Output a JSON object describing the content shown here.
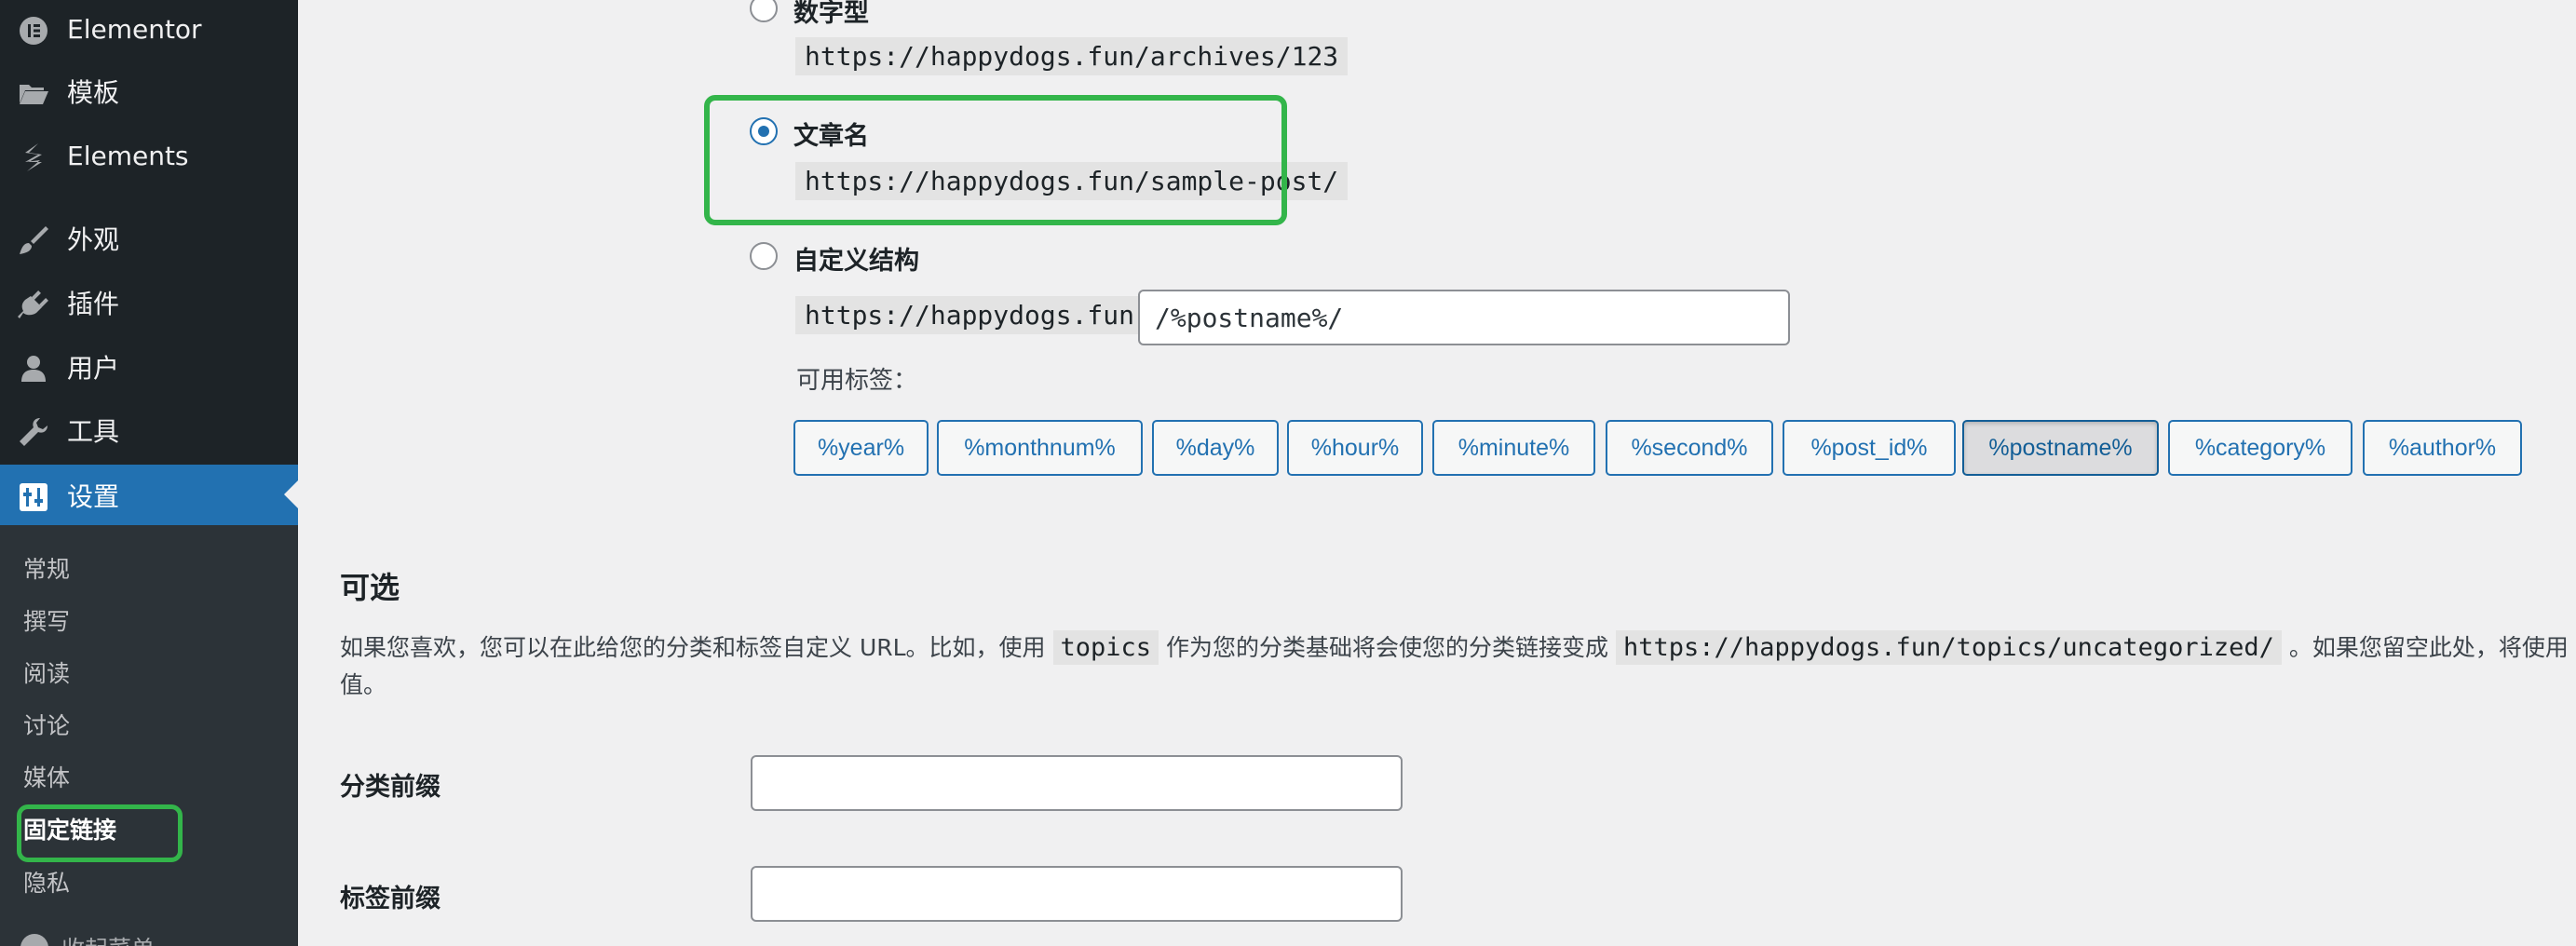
{
  "sidebar": {
    "menu": [
      {
        "label": "Elementor",
        "icon": "elementor-icon"
      },
      {
        "label": "模板",
        "icon": "folder-icon"
      },
      {
        "label": "Elements",
        "icon": "elements-icon"
      },
      {
        "label": "外观",
        "icon": "paintbrush-icon"
      },
      {
        "label": "插件",
        "icon": "plugin-icon"
      },
      {
        "label": "用户",
        "icon": "user-icon"
      },
      {
        "label": "工具",
        "icon": "wrench-icon"
      },
      {
        "label": "设置",
        "icon": "settings-icon"
      }
    ],
    "submenu": [
      "常规",
      "撰写",
      "阅读",
      "讨论",
      "媒体",
      "固定链接",
      "隐私",
      "收起菜单"
    ]
  },
  "permalink": {
    "numeric": {
      "label": "数字型",
      "example": "https://happydogs.fun/archives/123"
    },
    "post_name": {
      "label": "文章名",
      "example": "https://happydogs.fun/sample-post/"
    },
    "custom": {
      "label": "自定义结构",
      "prefix": "https://happydogs.fun",
      "value": "/%postname%/"
    },
    "available_tags_label": "可用标签：",
    "tags": [
      "%year%",
      "%monthnum%",
      "%day%",
      "%hour%",
      "%minute%",
      "%second%",
      "%post_id%",
      "%postname%",
      "%category%",
      "%author%"
    ]
  },
  "optional": {
    "title": "可选",
    "desc_1": "如果您喜欢，您可以在此给您的分类和标签自定义 URL。比如，使用 ",
    "desc_code1": "topics",
    "desc_2": " 作为您的分类基础将会使您的分类链接变成 ",
    "desc_code2": "https://happydogs.fun/topics/uncategorized/",
    "desc_3": " 。如果您留空此处，将使用",
    "desc_line2": "值。",
    "category_label": "分类前缀",
    "tag_label": "标签前缀",
    "category_value": "",
    "tag_value": ""
  },
  "colors": {
    "sidebar_bg": "#1d2327",
    "accent": "#2271b1",
    "highlight": "#33b54a"
  }
}
